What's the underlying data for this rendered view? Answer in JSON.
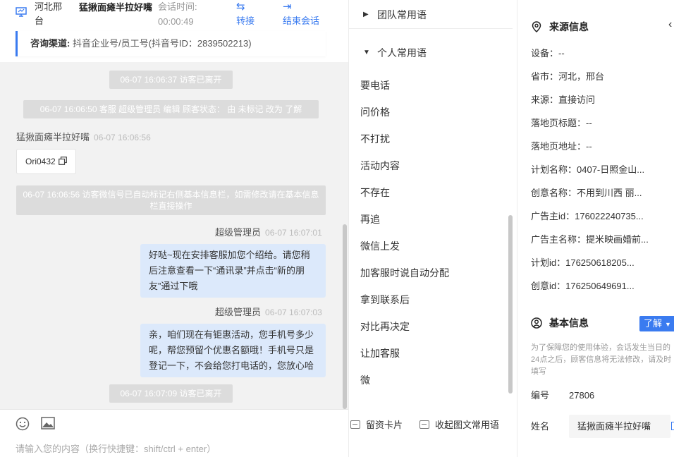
{
  "header": {
    "region": "河北邢台",
    "visitor_name": "猛揪面瘫半拉好嘴",
    "session_time_label": "会话时间:",
    "session_time_value": "00:00:49",
    "transfer_label": "转接",
    "end_label": "结束会话"
  },
  "channel": {
    "label": "咨询渠道:",
    "value": "抖音企业号/员工号(抖音号ID：2839502213)"
  },
  "messages": {
    "sys1": "06-07 16:06:37 访客已离开",
    "sys2": "06-07 16:06:50 客服 超级管理员 编辑 顾客状态： 由 未标记 改为 了解",
    "visitor_name": "猛揪面瘫半拉好嘴",
    "visitor_time": "06-07 16:06:56",
    "visitor_text": "Ori0432",
    "sys3": "06-07 16:06:56 访客微信号已自动标记右侧基本信息栏，如需修改请在基本信息栏直接操作",
    "agent1_name": "超级管理员",
    "agent1_time": "06-07 16:07:01",
    "agent1_text": "好哒~现在安排客服加您个绍给。请您稍后注意查看一下“通讯录”并点击“新的朋友”通过下哦",
    "agent2_name": "超级管理员",
    "agent2_time": "06-07 16:07:03",
    "agent2_text": "亲，咱们现在有钜惠活动，您手机号多少呢，帮您预留个优惠名额哦！手机号只是登记一下，不会给您打电话的，您放心哈",
    "sys4": "06-07 16:07:09 访客已离开"
  },
  "input": {
    "placeholder": "请输入您的内容（换行快捷键：shift/ctrl + enter）"
  },
  "phrases": {
    "team_group": "团队常用语",
    "personal_group": "个人常用语",
    "items": [
      "要电话",
      "问价格",
      "不打扰",
      "活动内容",
      "不存在",
      "再追",
      "微信上发",
      "加客服时说自动分配",
      "拿到联系后",
      "对比再决定",
      "让加客服",
      "微"
    ],
    "card_btn": "留资卡片",
    "collapse_btn": "收起图文常用语"
  },
  "source_info": {
    "title": "来源信息",
    "device": "设备：--",
    "province": "省市：河北，邢台",
    "source": "来源：直接访问",
    "landing_title": "落地页标题：--",
    "landing_url": "落地页地址：--",
    "plan_name": "计划名称：0407-日照金山...",
    "creative_name": "创意名称：不用到川西 丽...",
    "advertiser_id": "广告主id：176022240735...",
    "advertiser_name": "广告主名称：提米映画婚前...",
    "plan_id": "计划id：176250618205...",
    "creative_id": "创意id：176250649691..."
  },
  "basic_info": {
    "title": "基本信息",
    "status_btn": "了解",
    "notice": "为了保障您的使用体验，会话发生当日的24点之后，顾客信息将无法修改，请及时填写",
    "number_label": "编号",
    "number_value": "27806",
    "name_label": "姓名",
    "name_value": "猛揪面瘫半拉好嘴"
  },
  "colors": {
    "accent": "#3a7bf0",
    "bubble": "#dce9fb",
    "pill": "#dcdcdc"
  }
}
